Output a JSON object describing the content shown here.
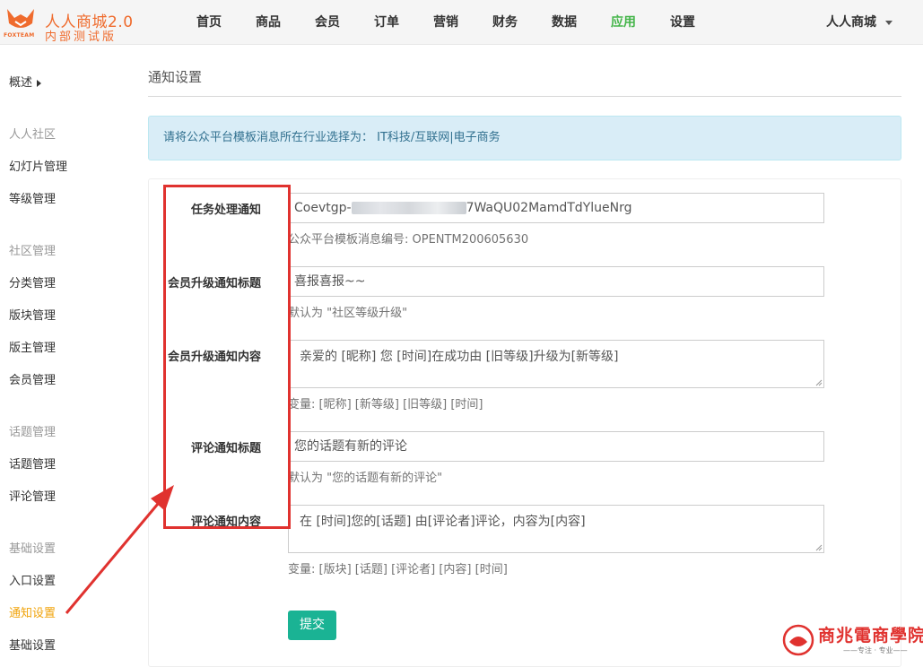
{
  "brand": {
    "title": "人人商城2.0",
    "subtitle": "内部测试版",
    "logo_text": "FOXTEAM",
    "accent": "#ef6b2d"
  },
  "nav": {
    "items": [
      "首页",
      "商品",
      "会员",
      "订单",
      "营销",
      "财务",
      "数据",
      "应用",
      "设置"
    ],
    "active_item": "应用",
    "active_color": "#44b549",
    "user_menu": "人人商城"
  },
  "sidebar": {
    "overview": "概述",
    "groups": [
      {
        "title": "人人社区",
        "items": [
          "幻灯片管理",
          "等级管理"
        ]
      },
      {
        "title": "社区管理",
        "items": [
          "分类管理",
          "版块管理",
          "版主管理",
          "会员管理"
        ]
      },
      {
        "title": "话题管理",
        "items": [
          "话题管理",
          "评论管理"
        ]
      },
      {
        "title": "基础设置",
        "items": [
          "入口设置",
          "通知设置",
          "基础设置"
        ]
      }
    ],
    "active_item": "通知设置",
    "active_color": "#f0a30a"
  },
  "main": {
    "page_title": "通知设置",
    "alert": "请将公众平台模板消息所在行业选择为： IT科技/互联网|电子商务",
    "form": {
      "task_label": "任务处理通知",
      "task_value_prefix": "Coevtgp-",
      "task_value_suffix": "7WaQU02MamdTdYlueNrg",
      "task_help": "公众平台模板消息编号: OPENTM200605630",
      "upgrade_title_label": "会员升级通知标题",
      "upgrade_title_value": "喜报喜报~~",
      "upgrade_title_help": "默认为 \"社区等级升级\"",
      "upgrade_content_label": "会员升级通知内容",
      "upgrade_content_value": "亲爱的 [昵称] 您 [时间]在成功由 [旧等级]升级为[新等级]",
      "upgrade_content_help": "变量: [昵称] [新等级] [旧等级] [时间]",
      "comment_title_label": "评论通知标题",
      "comment_title_value": "您的话题有新的评论",
      "comment_title_help": "默认为 \"您的话题有新的评论\"",
      "comment_content_label": "评论通知内容",
      "comment_content_value": "在 [时间]您的[话题] 由[评论者]评论，内容为[内容]",
      "comment_content_help": "变量: [版块] [话题] [评论者] [内容] [时间]",
      "submit": "提交",
      "submit_color": "#1ab394"
    }
  },
  "watermark": {
    "text": "商兆電商學院",
    "sub": "——专注 · 专业——"
  },
  "annotation_color": "#e0322f"
}
